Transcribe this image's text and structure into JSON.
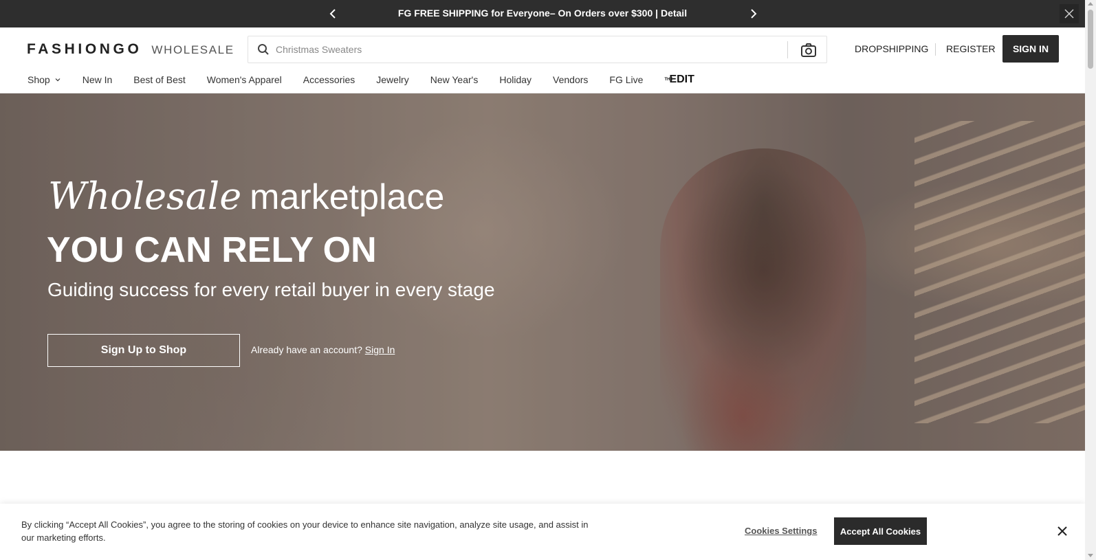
{
  "promo": {
    "text": "FG FREE SHIPPING for Everyone– On Orders over $300 | Detail",
    "prev_icon": "chevron-left-icon",
    "next_icon": "chevron-right-icon",
    "close_icon": "close-icon"
  },
  "header": {
    "logo_main": "FASHIONGO",
    "logo_sub": "WHOLESALE",
    "search_placeholder": "Christmas Sweaters",
    "dropshipping": "DROPSHIPPING",
    "register": "REGISTER",
    "signin": "SIGN IN"
  },
  "nav": {
    "items": [
      "Shop",
      "New In",
      "Best of Best",
      "Women's Apparel",
      "Accessories",
      "Jewelry",
      "New Year's",
      "Holiday",
      "Vendors",
      "FG Live"
    ],
    "edit_prefix": "THE",
    "edit_label": "EDIT"
  },
  "hero": {
    "italic": "Wholesale",
    "light": "marketplace",
    "headline": "YOU CAN RELY ON",
    "subtitle": "Guiding success for every retail buyer in every stage",
    "cta": "Sign Up to Shop",
    "already": "Already have an account?",
    "signin_link": "Sign In"
  },
  "cookie": {
    "text": "By clicking “Accept All Cookies”, you agree to the storing of cookies on your device to enhance site navigation, analyze site usage, and assist in our marketing efforts.",
    "settings": "Cookies Settings",
    "accept": "Accept All Cookies"
  },
  "colors": {
    "promo_bg": "#2e2e2e",
    "button_dark": "#2b2b2b"
  }
}
